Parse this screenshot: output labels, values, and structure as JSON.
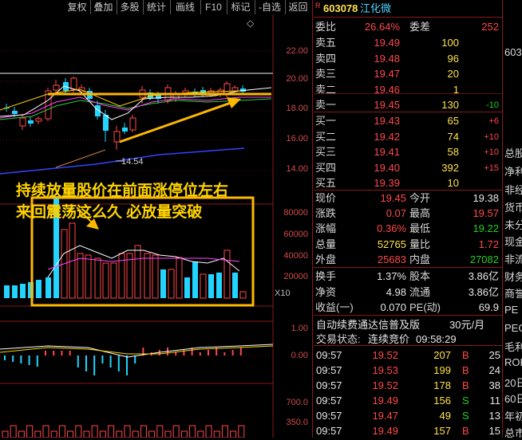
{
  "toolbar": {
    "items": [
      "复权",
      "叠加",
      "多股",
      "统计",
      "画线",
      "F10",
      "标记",
      "-自选",
      "返回"
    ]
  },
  "stock": {
    "badge": "R",
    "code": "603078",
    "name": "江化微"
  },
  "chart": {
    "price_ticks": [
      "22.00",
      "20.00",
      "18.00",
      "16.00",
      "14.00"
    ],
    "low_marker": "14.54",
    "volume_ticks": [
      "80000",
      "60000",
      "40000",
      "20000"
    ],
    "volume_unit": "X10",
    "macd_ticks": [
      "1.00",
      "0.00"
    ],
    "bottom_ticks": [
      "700.0",
      "350.0"
    ],
    "annotation_line1": "持续放量股价在前面涨停位左右",
    "annotation_line2": "来回震荡这么久  必放量突破",
    "top_right_icon": "◇"
  },
  "order_book": {
    "weibi_label": "委比",
    "weibi_value": "26.64%",
    "weicha_label": "委差",
    "weicha_value": "252",
    "asks": [
      {
        "label": "卖五",
        "price": "19.49",
        "vol": "100",
        "chg": ""
      },
      {
        "label": "卖四",
        "price": "19.48",
        "vol": "96",
        "chg": ""
      },
      {
        "label": "卖三",
        "price": "19.47",
        "vol": "20",
        "chg": ""
      },
      {
        "label": "卖二",
        "price": "19.46",
        "vol": "1",
        "chg": ""
      },
      {
        "label": "卖一",
        "price": "19.45",
        "vol": "130",
        "chg": "-10"
      }
    ],
    "bids": [
      {
        "label": "买一",
        "price": "19.43",
        "vol": "65",
        "chg": "+6"
      },
      {
        "label": "买二",
        "price": "19.42",
        "vol": "74",
        "chg": "+10"
      },
      {
        "label": "买三",
        "price": "19.41",
        "vol": "58",
        "chg": "+10"
      },
      {
        "label": "买四",
        "price": "19.40",
        "vol": "392",
        "chg": "+15"
      },
      {
        "label": "买五",
        "price": "19.39",
        "vol": "10",
        "chg": ""
      }
    ]
  },
  "quote": {
    "rows": [
      {
        "l1": "现价",
        "v1": "19.45",
        "l2": "今开",
        "v2": "19.38",
        "c1": "red",
        "c2": "wht"
      },
      {
        "l1": "涨跌",
        "v1": "0.07",
        "l2": "最高",
        "v2": "19.57",
        "c1": "red",
        "c2": "red"
      },
      {
        "l1": "涨幅",
        "v1": "0.36%",
        "l2": "最低",
        "v2": "19.22",
        "c1": "red",
        "c2": "grn"
      },
      {
        "l1": "总量",
        "v1": "52765",
        "l2": "量比",
        "v2": "1.72",
        "c1": "yel",
        "c2": "red"
      },
      {
        "l1": "外盘",
        "v1": "25683",
        "l2": "内盘",
        "v2": "27082",
        "c1": "red",
        "c2": "grn"
      }
    ],
    "rows2": [
      {
        "l1": "换手",
        "v1": "1.37%",
        "l2": "股本",
        "v2": "3.86亿"
      },
      {
        "l1": "净资",
        "v1": "4.98",
        "l2": "流通",
        "v2": "3.86亿"
      },
      {
        "l1": "收益(一)",
        "v1": "0.070",
        "l2": "PE(动)",
        "v2": "69.9"
      }
    ]
  },
  "subscription": {
    "text": "自动续费通达信普及版",
    "price": "30元/月"
  },
  "trade_status": {
    "label": "交易状态:",
    "value": "连续竞价",
    "time": "09:58:29"
  },
  "ticks": [
    {
      "time": "09:57",
      "price": "19.52",
      "vol": "207",
      "side": "B",
      "num": "25"
    },
    {
      "time": "09:57",
      "price": "19.53",
      "vol": "199",
      "side": "B",
      "num": "24"
    },
    {
      "time": "09:57",
      "price": "19.52",
      "vol": "178",
      "side": "B",
      "num": "38"
    },
    {
      "time": "09:57",
      "price": "19.49",
      "vol": "156",
      "side": "S",
      "num": "11"
    },
    {
      "time": "09:57",
      "price": "19.47",
      "vol": "49",
      "side": "S",
      "num": "13"
    },
    {
      "time": "09:57",
      "price": "19.49",
      "vol": "157",
      "side": "B",
      "num": "15"
    }
  ],
  "far_panel": {
    "top": "603",
    "items": [
      "总股",
      "净利",
      "非经",
      "货币",
      "未分",
      "现金",
      "非流",
      "财务",
      "商誉",
      "PE",
      "PEG",
      "毛利",
      "ROE",
      "20日",
      "60日",
      "年初",
      "总市"
    ]
  },
  "colors": {
    "up": "#ff4848",
    "down": "#22d4ff",
    "annotation": "#ffd400",
    "grid": "#8a1818"
  }
}
